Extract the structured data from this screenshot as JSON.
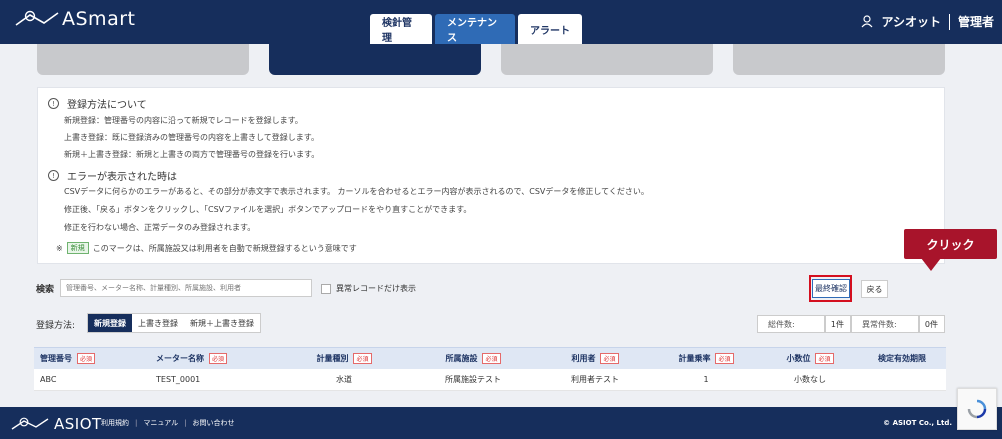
{
  "header": {
    "logo": "ASmart",
    "tabs": [
      {
        "label": "検針管理"
      },
      {
        "label": "メンテナンス"
      },
      {
        "label": "アラート"
      }
    ],
    "user_name": "アシオット",
    "user_role": "管理者"
  },
  "info": {
    "section1_title": "登録方法について",
    "section1_lines": [
      "新規登録：管理番号の内容に沿って新規でレコードを登録します。",
      "上書き登録：既に登録済みの管理番号の内容を上書きして登録します。",
      "新規＋上書き登録：新規と上書きの両方で管理番号の登録を行います。"
    ],
    "section2_title": "エラーが表示された時は",
    "section2_lines": [
      "CSVデータに何らかのエラーがあると、その部分が赤文字で表示されます。 カーソルを合わせるとエラー内容が表示されるので、CSVデータを修正してください。",
      "修正後、「戻る」ボタンをクリックし、「CSVファイルを選択」ボタンでアップロードをやり直すことができます。",
      "修正を行わない場合、正常データのみ登録されます。"
    ],
    "note_prefix": "※",
    "note_badge": "新規",
    "note_text": "このマークは、所属施設又は利用者を自動で新規登録するという意味です"
  },
  "callout": "クリック",
  "search": {
    "label": "検索",
    "placeholder": "管理番号、メーター名称、計量種別、所属施設、利用者",
    "abnormal_only_label": "異常レコードだけ表示"
  },
  "actions": {
    "back": "戻る",
    "confirm": "最終確認"
  },
  "registration": {
    "label": "登録方法:",
    "options": [
      "新規登録",
      "上書き登録",
      "新規＋上書き登録"
    ],
    "selected": "新規登録"
  },
  "counts": {
    "total_label": "総件数:",
    "total_value": "1件",
    "error_label": "異常件数:",
    "error_value": "0件"
  },
  "table": {
    "required_badge": "必須",
    "columns": [
      {
        "label": "管理番号",
        "required": true
      },
      {
        "label": "メーター名称",
        "required": true
      },
      {
        "label": "計量種別",
        "required": true
      },
      {
        "label": "所属施設",
        "required": true
      },
      {
        "label": "利用者",
        "required": true
      },
      {
        "label": "計量乗率",
        "required": true
      },
      {
        "label": "小数位",
        "required": true
      },
      {
        "label": "検定有効期限",
        "required": false
      }
    ],
    "rows": [
      [
        "ABC",
        "TEST_0001",
        "水道",
        "所属施設テスト",
        "利用者テスト",
        "1",
        "小数なし",
        ""
      ]
    ]
  },
  "footer": {
    "logo": "ASIOT",
    "links": [
      "利用規約",
      "マニュアル",
      "お問い合わせ"
    ],
    "separator": "|",
    "copyright": "© ASIOT Co., Ltd."
  },
  "colors": {
    "navy": "#162e5c",
    "accent_blue": "#2f6bb6",
    "highlight_red": "#d40f1f",
    "callout_red": "#a8142b"
  },
  "icons": [
    "user-icon",
    "info-icon",
    "checkbox-icon",
    "recaptcha-icon"
  ]
}
